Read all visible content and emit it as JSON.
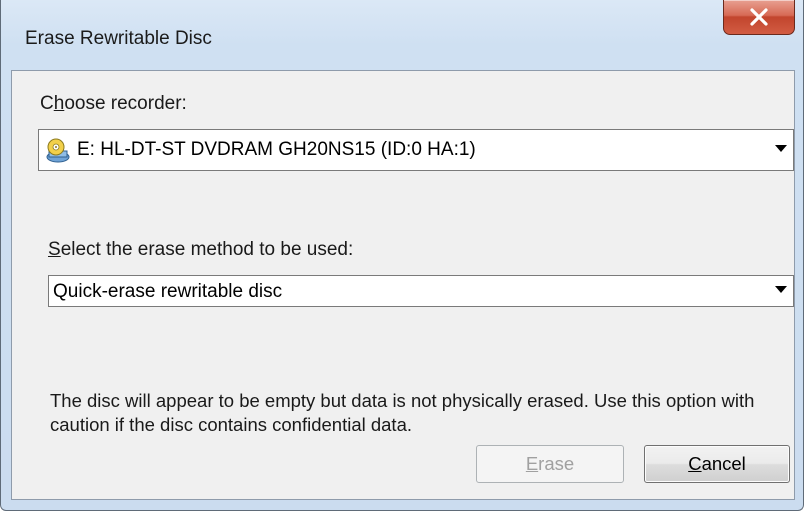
{
  "window": {
    "title": "Erase Rewritable Disc",
    "close_button": "X"
  },
  "recorder": {
    "label_accel": "h",
    "label_pre": "C",
    "label_post": "oose recorder:",
    "selected": "E: HL-DT-ST DVDRAM GH20NS15  (ID:0 HA:1)",
    "icon": "disc-drive-icon"
  },
  "erase_method": {
    "label_accel": "S",
    "label_post": "elect the erase method to be used:",
    "selected": "Quick-erase rewritable disc",
    "description": "The disc will appear to be empty but data is not physically erased. Use this option with caution if the disc contains confidential data."
  },
  "buttons": {
    "erase_accel": "E",
    "erase_rest": "rase",
    "erase_enabled": false,
    "cancel_accel": "C",
    "cancel_rest": "ancel"
  }
}
